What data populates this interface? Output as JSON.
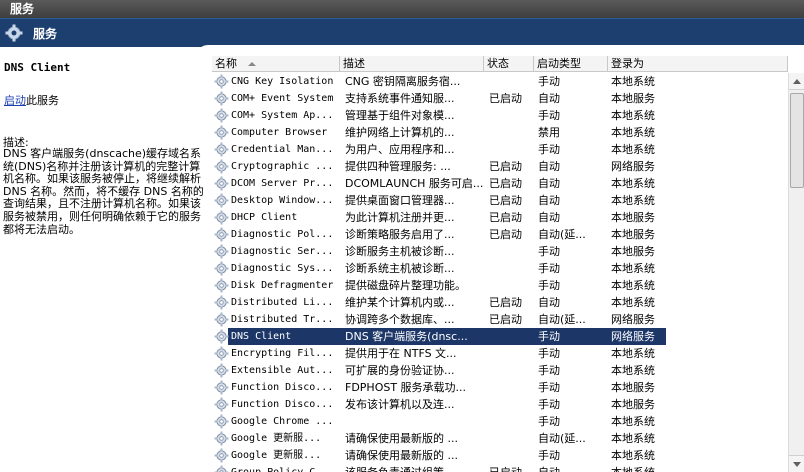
{
  "window": {
    "title": "服务"
  },
  "header": {
    "title": "服务"
  },
  "left_pane": {
    "service_name": "DNS Client",
    "start_link": "启动",
    "start_suffix": "此服务",
    "desc_heading": "描述:",
    "description": "DNS 客户端服务(dnscache)缓存域名系统(DNS)名称并注册该计算机的完整计算机名称。如果该服务被停止，将继续解析 DNS 名称。然而，将不缓存 DNS 名称的查询结果，且不注册计算机名称。如果该服务被禁用，则任何明确依赖于它的服务都将无法启动。"
  },
  "columns": {
    "name": "名称",
    "desc": "描述",
    "state": "状态",
    "startup": "启动类型",
    "logon": "登录为"
  },
  "rows": [
    {
      "name": "CNG Key Isolation",
      "desc": "CNG 密钥隔离服务宿...",
      "state": "",
      "startup": "手动",
      "logon": "本地系统"
    },
    {
      "name": "COM+ Event System",
      "desc": "支持系统事件通知服...",
      "state": "已启动",
      "startup": "自动",
      "logon": "本地服务"
    },
    {
      "name": "COM+ System Ap...",
      "desc": "管理基于组件对象模...",
      "state": "",
      "startup": "手动",
      "logon": "本地系统"
    },
    {
      "name": "Computer Browser",
      "desc": "维护网络上计算机的...",
      "state": "",
      "startup": "禁用",
      "logon": "本地系统"
    },
    {
      "name": "Credential Man...",
      "desc": "为用户、应用程序和...",
      "state": "",
      "startup": "手动",
      "logon": "本地系统"
    },
    {
      "name": "Cryptographic ...",
      "desc": "提供四种管理服务: ...",
      "state": "已启动",
      "startup": "自动",
      "logon": "网络服务"
    },
    {
      "name": "DCOM Server Pr...",
      "desc": "DCOMLAUNCH 服务可启...",
      "state": "已启动",
      "startup": "自动",
      "logon": "本地系统"
    },
    {
      "name": "Desktop Window...",
      "desc": "提供桌面窗口管理器...",
      "state": "已启动",
      "startup": "自动",
      "logon": "本地系统"
    },
    {
      "name": "DHCP Client",
      "desc": "为此计算机注册并更...",
      "state": "已启动",
      "startup": "自动",
      "logon": "本地服务"
    },
    {
      "name": "Diagnostic Pol...",
      "desc": "诊断策略服务启用了...",
      "state": "已启动",
      "startup": "自动(延...",
      "logon": "本地服务"
    },
    {
      "name": "Diagnostic Ser...",
      "desc": "诊断服务主机被诊断...",
      "state": "",
      "startup": "手动",
      "logon": "本地服务"
    },
    {
      "name": "Diagnostic Sys...",
      "desc": "诊断系统主机被诊断...",
      "state": "",
      "startup": "手动",
      "logon": "本地系统"
    },
    {
      "name": "Disk Defragmenter",
      "desc": "提供磁盘碎片整理功能。",
      "state": "",
      "startup": "手动",
      "logon": "本地系统"
    },
    {
      "name": "Distributed Li...",
      "desc": "维护某个计算机内或...",
      "state": "已启动",
      "startup": "自动",
      "logon": "本地系统"
    },
    {
      "name": "Distributed Tr...",
      "desc": "协调跨多个数据库、...",
      "state": "已启动",
      "startup": "自动(延...",
      "logon": "网络服务"
    },
    {
      "name": "DNS Client",
      "desc": "DNS 客户端服务(dnsc...",
      "state": "",
      "startup": "手动",
      "logon": "网络服务",
      "selected": true
    },
    {
      "name": "Encrypting Fil...",
      "desc": "提供用于在 NTFS 文...",
      "state": "",
      "startup": "手动",
      "logon": "本地系统"
    },
    {
      "name": "Extensible Aut...",
      "desc": "可扩展的身份验证协...",
      "state": "",
      "startup": "手动",
      "logon": "本地系统"
    },
    {
      "name": "Function Disco...",
      "desc": "FDPHOST 服务承载功...",
      "state": "",
      "startup": "手动",
      "logon": "本地服务"
    },
    {
      "name": "Function Disco...",
      "desc": "发布该计算机以及连...",
      "state": "",
      "startup": "手动",
      "logon": "本地服务"
    },
    {
      "name": "Google Chrome ...",
      "desc": "",
      "state": "",
      "startup": "手动",
      "logon": "本地系统"
    },
    {
      "name": "Google 更新服...",
      "desc": "请确保使用最新版的 ...",
      "state": "",
      "startup": "自动(延...",
      "logon": "本地系统"
    },
    {
      "name": "Google 更新服...",
      "desc": "请确保使用最新版的 ...",
      "state": "",
      "startup": "手动",
      "logon": "本地系统"
    },
    {
      "name": "Group Policy C...",
      "desc": "该服务负责通过组策...",
      "state": "已启动",
      "startup": "自动",
      "logon": "本地系统"
    }
  ]
}
